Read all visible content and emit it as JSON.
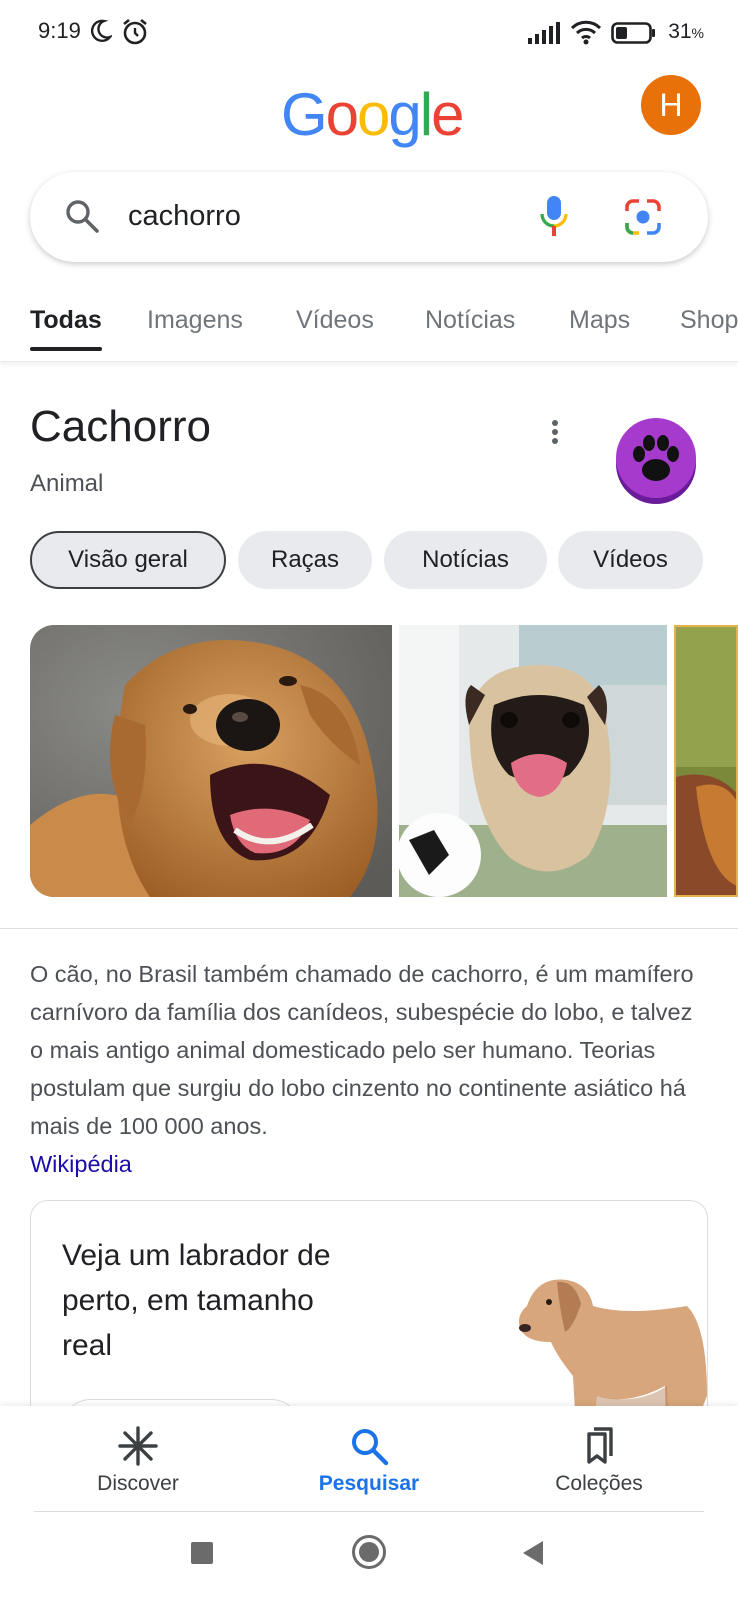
{
  "status_bar": {
    "time": "9:19",
    "battery": "31",
    "battery_unit": "%",
    "icons": [
      "moon-icon",
      "alarm-icon",
      "signal-icon",
      "wifi-icon",
      "battery-icon"
    ]
  },
  "header": {
    "logo": "Google",
    "avatar_letter": "H",
    "avatar_color": "#E8710A"
  },
  "search": {
    "query": "cachorro",
    "icons": [
      "search-icon",
      "mic-icon",
      "lens-icon"
    ]
  },
  "tabs": [
    {
      "label": "Todas",
      "active": true
    },
    {
      "label": "Imagens",
      "active": false
    },
    {
      "label": "Vídeos",
      "active": false
    },
    {
      "label": "Notícias",
      "active": false
    },
    {
      "label": "Maps",
      "active": false
    },
    {
      "label": "Shop",
      "active": false
    }
  ],
  "knowledge_panel": {
    "title": "Cachorro",
    "subtitle": "Animal",
    "badge_color": "#9C27B0",
    "chips": [
      {
        "label": "Visão geral",
        "selected": true
      },
      {
        "label": "Raças",
        "selected": false
      },
      {
        "label": "Notícias",
        "selected": false
      },
      {
        "label": "Vídeos",
        "selected": false
      }
    ],
    "images": [
      "golden-retriever-photo",
      "pug-photo",
      "dog-photo-partial"
    ],
    "description": "O cão, no Brasil também chamado de cachorro, é um mamífero carnívoro da família dos canídeos, subespécie do lobo, e talvez o mais antigo animal domesticado pelo ser humano. Teorias postulam que surgiu do lobo cinzento no continente asiático há mais de 100 000 anos.",
    "source_link": "Wikipédia",
    "ar_card": {
      "text": "Veja um labrador de perto, em tamanho real"
    }
  },
  "bottom_nav": [
    {
      "label": "Discover",
      "icon": "asterisk-icon",
      "active": false
    },
    {
      "label": "Pesquisar",
      "icon": "search-icon",
      "active": true
    },
    {
      "label": "Coleções",
      "icon": "collections-icon",
      "active": false
    }
  ],
  "colors": {
    "accent": "#1a73e8",
    "link": "#1a0dab",
    "google_blue": "#4285F4",
    "google_red": "#EA4335",
    "google_yellow": "#FBBC05",
    "google_green": "#34A853"
  }
}
